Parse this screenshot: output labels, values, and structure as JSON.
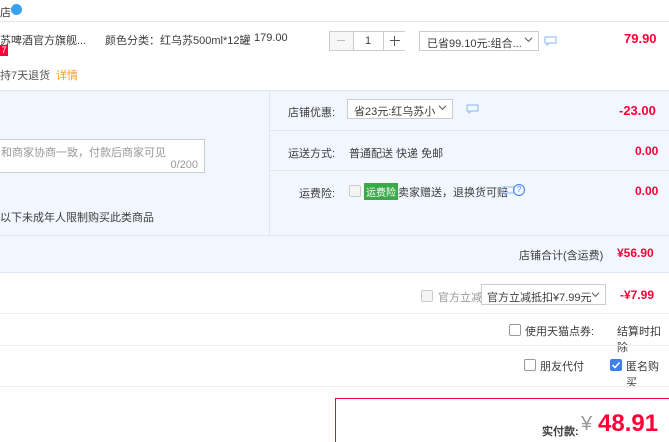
{
  "item": {
    "shop_tail": "店",
    "title": "苏啤酒官方旗舰...",
    "sku_label": "颜色分类：红乌苏500ml*12罐",
    "badge": "7",
    "price": "179.00",
    "qty": "1",
    "promo_select": "已省99.10元:组合...",
    "subtotal": "79.90",
    "service": "持7天退货",
    "service_link": "详情"
  },
  "order": {
    "memo_placeholder": "和商家协商一致，付款后商家可见",
    "memo_count": "0/200",
    "notice": "以下未成年人限制购买此类商品",
    "shop_discount_label": "店铺优惠:",
    "shop_discount_select": "省23元:红乌苏小",
    "shop_discount_value": "-23.00",
    "shipping_label": "运送方式:",
    "shipping_value": "普通配送 快递 免邮",
    "shipping_price": "0.00",
    "insurance_label": "运费险:",
    "insurance_tag": "运费险",
    "insurance_text": "卖家赠送，退换货可赔",
    "insurance_price": "0.00",
    "shop_total_label": "店铺合计(含运费)",
    "shop_total_value": "¥56.90"
  },
  "summary": {
    "official_label": "官方立减",
    "official_select": "官方立减抵扣¥7.99元",
    "official_value": "-¥7.99",
    "points_label": "使用天猫点券:",
    "points_right": "结算时扣除",
    "friend_pay": "朋友代付",
    "anon": "匿名购买",
    "pay_label": "实付款:",
    "pay_currency": "¥",
    "pay_amount": "48.91"
  },
  "colors": {
    "accent": "#ff0036",
    "panel_bg": "#f2f7ff",
    "insurance_green": "#3ba84a",
    "checkbox_blue": "#3d7ef3"
  }
}
